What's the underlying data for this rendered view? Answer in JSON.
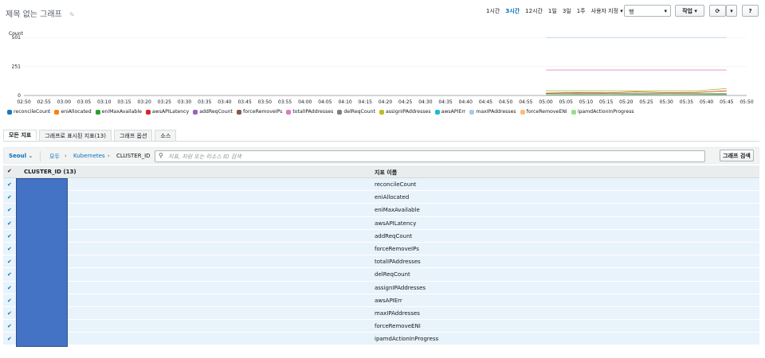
{
  "header": {
    "title": "제목 없는 그래프",
    "time_ranges": [
      "1시간",
      "3시간",
      "12시간",
      "1일",
      "3일",
      "1주"
    ],
    "active_range": "3시간",
    "custom_label": "사용자 지정",
    "view_select": "행",
    "action_label": "작업",
    "refresh_icon": "refresh-icon",
    "help_label": "?"
  },
  "tabs": [
    "모든 지표",
    "그래프로 표시된 지표(13)",
    "그래프 옵션",
    "소스"
  ],
  "filter": {
    "region": "Seoul",
    "crumbs": [
      "모두",
      "Kubernetes"
    ],
    "current": "CLUSTER_ID",
    "search_placeholder": "지표, 차원 또는 리소스 ID 검색",
    "graph_search_label": "그래프 검색"
  },
  "table": {
    "col1": "CLUSTER_ID (13)",
    "col2": "지표 이름",
    "rows": [
      "reconcileCount",
      "eniAllocated",
      "eniMaxAvailable",
      "awsAPILatency",
      "addReqCount",
      "forceRemoveIPs",
      "totalIPAddresses",
      "delReqCount",
      "assignIPAddresses",
      "awsAPIErr",
      "maxIPAddresses",
      "forceRemoveENI",
      "ipamdActionInProgress"
    ]
  },
  "chart_data": {
    "type": "line",
    "ylabel": "Count",
    "yticks": [
      0,
      251,
      501
    ],
    "x": [
      "02:50",
      "02:55",
      "03:00",
      "03:05",
      "03:10",
      "03:15",
      "03:20",
      "03:25",
      "03:30",
      "03:35",
      "03:40",
      "03:45",
      "03:50",
      "03:55",
      "04:00",
      "04:05",
      "04:10",
      "04:15",
      "04:20",
      "04:25",
      "04:30",
      "04:35",
      "04:40",
      "04:45",
      "04:50",
      "04:55",
      "05:00",
      "05:05",
      "05:10",
      "05:15",
      "05:20",
      "05:25",
      "05:30",
      "05:35",
      "05:40",
      "05:45",
      "05:50"
    ],
    "series": [
      {
        "name": "reconcileCount",
        "color": "#1f77b4",
        "values": [
          0,
          0,
          0,
          0,
          0,
          0,
          0
        ]
      },
      {
        "name": "eniAllocated",
        "color": "#ff7f0e",
        "values": [
          3,
          3,
          3,
          3,
          3,
          3,
          3
        ]
      },
      {
        "name": "eniMaxAvailable",
        "color": "#2ca02c",
        "values": [
          15,
          15,
          15,
          15,
          15,
          15,
          15
        ]
      },
      {
        "name": "awsAPILatency",
        "color": "#d62728",
        "values": [
          20,
          25,
          22,
          30,
          24,
          26,
          40
        ]
      },
      {
        "name": "addReqCount",
        "color": "#9467bd",
        "values": [
          4,
          6,
          5,
          7,
          5,
          6,
          8
        ]
      },
      {
        "name": "forceRemoveIPs",
        "color": "#8c564b",
        "values": [
          0,
          0,
          0,
          0,
          0,
          0,
          0
        ]
      },
      {
        "name": "totalIPAddresses",
        "color": "#e377c2",
        "values": [
          220,
          220,
          220,
          220,
          220,
          220,
          220
        ]
      },
      {
        "name": "delReqCount",
        "color": "#7f7f7f",
        "values": [
          3,
          5,
          4,
          6,
          4,
          5,
          7
        ]
      },
      {
        "name": "assignIPAddresses",
        "color": "#bcbd22",
        "values": [
          40,
          40,
          40,
          40,
          40,
          40,
          60
        ]
      },
      {
        "name": "awsAPIErr",
        "color": "#17becf",
        "values": [
          0,
          0,
          0,
          0,
          0,
          0,
          0
        ]
      },
      {
        "name": "maxIPAddresses",
        "color": "#aec7e8",
        "values": [
          501,
          501,
          501,
          501,
          501,
          501,
          501
        ]
      },
      {
        "name": "forceRemoveENI",
        "color": "#ffbb78",
        "values": [
          0,
          0,
          0,
          0,
          0,
          0,
          0
        ]
      },
      {
        "name": "ipamdActionInProgress",
        "color": "#98df8a",
        "values": [
          0,
          0,
          0,
          0,
          0,
          0,
          0
        ]
      }
    ],
    "series_x_start": "05:00",
    "series_x_end": "05:45",
    "ylim": [
      0,
      550
    ],
    "legend_position": "bottom"
  }
}
